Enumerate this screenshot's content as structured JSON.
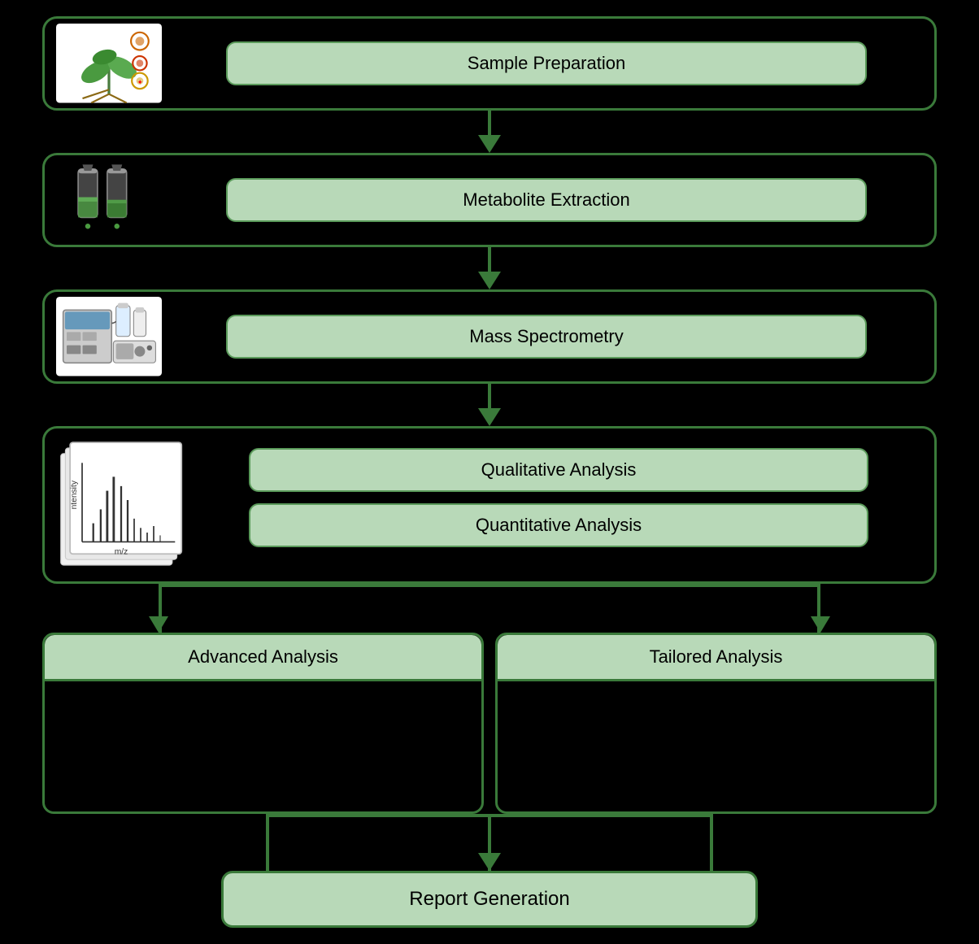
{
  "steps": [
    {
      "id": "sample-preparation",
      "label": "Sample Preparation",
      "imageType": "plant"
    },
    {
      "id": "metabolite-extraction",
      "label": "Metabolite Extraction",
      "imageType": "tubes"
    },
    {
      "id": "mass-spectrometry",
      "label": "Mass Spectrometry",
      "imageType": "machine"
    },
    {
      "id": "analysis-combined",
      "label1": "Qualitative Analysis",
      "label2": "Quantitative Analysis",
      "imageType": "spectra"
    }
  ],
  "split": {
    "left": "Advanced Analysis",
    "right": "Tailored Analysis"
  },
  "report": {
    "label": "Report Generation"
  }
}
